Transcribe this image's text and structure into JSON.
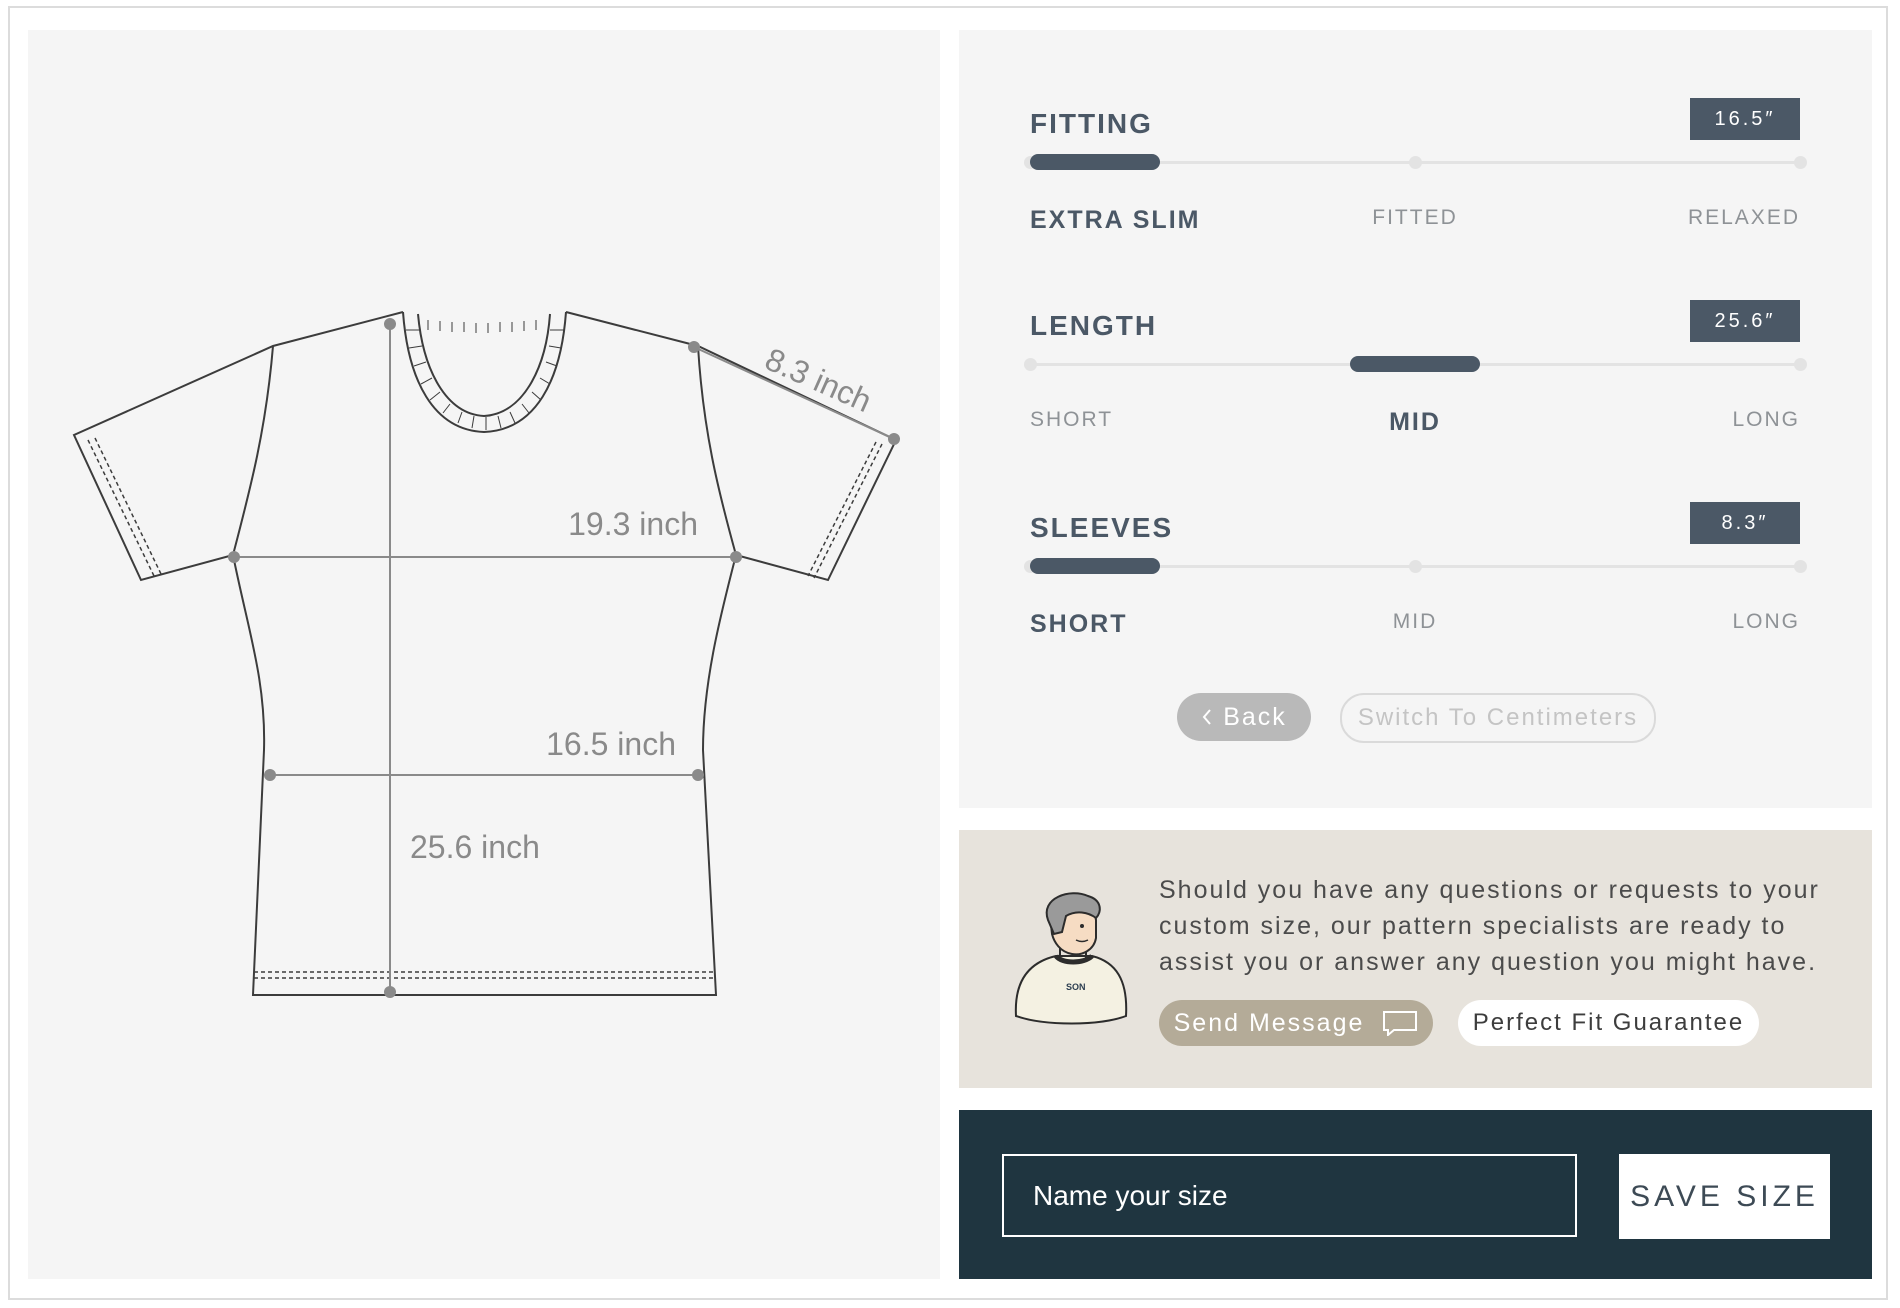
{
  "measurements": {
    "sleeve": "8.3 inch",
    "chest": "19.3 inch",
    "waist": "16.5 inch",
    "length": "25.6 inch"
  },
  "sliders": {
    "fitting": {
      "title": "FITTING",
      "value": "16.5″",
      "position": 0,
      "stops": [
        "EXTRA SLIM",
        "FITTED",
        "RELAXED"
      ],
      "selected": "EXTRA SLIM"
    },
    "length": {
      "title": "LENGTH",
      "value": "25.6″",
      "position": 0.5,
      "stops": [
        "SHORT",
        "MID",
        "LONG"
      ],
      "selected": "MID"
    },
    "sleeves": {
      "title": "SLEEVES",
      "value": "8.3″",
      "position": 0,
      "stops": [
        "SHORT",
        "MID",
        "LONG"
      ],
      "selected": "SHORT"
    }
  },
  "actions": {
    "back_label": "Back",
    "switch_units_label": "Switch To Centimeters"
  },
  "help": {
    "text": "Should you have any questions or requests to your custom size, our pattern specialists are ready to assist you or answer any question you might have.",
    "send_message_label": "Send Message",
    "guarantee_label": "Perfect Fit Guarantee",
    "avatar_shirt_text": "SON"
  },
  "save": {
    "input_placeholder": "Name your size",
    "input_value": "",
    "save_label": "SAVE SIZE"
  },
  "colors": {
    "accent": "#4b5866",
    "panel": "#f5f5f5",
    "help_panel": "#e7e3dc",
    "save_panel": "#1f3540",
    "send_button": "#b4ab98"
  }
}
